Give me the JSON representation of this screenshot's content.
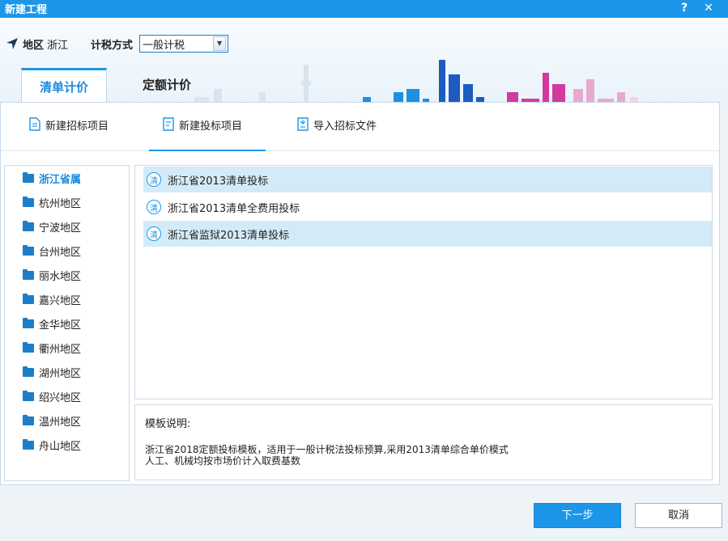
{
  "window": {
    "title": "新建工程",
    "help_label": "?",
    "close_label": "✕"
  },
  "header": {
    "region_label": "地区",
    "region_value": "浙江",
    "tax_label": "计税方式",
    "tax_value": "一般计税"
  },
  "main_tabs": [
    {
      "label": "清单计价",
      "active": true
    },
    {
      "label": "定额计价",
      "active": false
    }
  ],
  "sub_tabs": [
    {
      "label": "新建招标项目",
      "icon": "document-icon"
    },
    {
      "label": "新建投标项目",
      "icon": "document-edit-icon",
      "active": true
    },
    {
      "label": "导入招标文件",
      "icon": "import-file-icon"
    }
  ],
  "regions": [
    {
      "label": "浙江省属",
      "active": true
    },
    {
      "label": "杭州地区"
    },
    {
      "label": "宁波地区"
    },
    {
      "label": "台州地区"
    },
    {
      "label": "丽水地区"
    },
    {
      "label": "嘉兴地区"
    },
    {
      "label": "金华地区"
    },
    {
      "label": "衢州地区"
    },
    {
      "label": "湖州地区"
    },
    {
      "label": "绍兴地区"
    },
    {
      "label": "温州地区"
    },
    {
      "label": "舟山地区"
    }
  ],
  "templates": [
    {
      "icon_text": "清",
      "label": "浙江省2013清单投标",
      "highlighted": true
    },
    {
      "icon_text": "清",
      "label": "浙江省2013清单全费用投标",
      "highlighted": false
    },
    {
      "icon_text": "清",
      "label": "浙江省监狱2013清单投标",
      "highlighted": true
    }
  ],
  "description": {
    "title": "模板说明:",
    "line1": "浙江省2018定额投标模板，适用于一般计税法投标预算,采用2013清单综合单价模式",
    "line2": "人工、机械均按市场价计入取费基数"
  },
  "buttons": {
    "next": "下一步",
    "cancel": "取消"
  },
  "colors": {
    "accent": "#1c96e8",
    "selection": "#d3ebf9"
  }
}
